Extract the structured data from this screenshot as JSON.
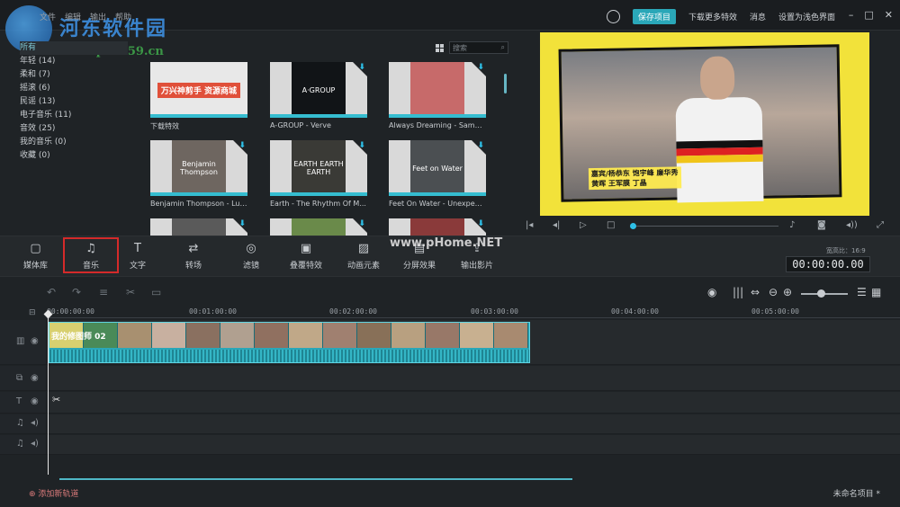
{
  "menu": [
    "文件",
    "编辑",
    "输出",
    "帮助"
  ],
  "watermark": {
    "site": "河东软件园",
    "url": "www.pc0359.cn",
    "overlay": "www.pHome.NET"
  },
  "titlebar": {
    "save": "保存项目",
    "download_effects": "下载更多特效",
    "messages": "消息",
    "light_theme": "设置为浅色界面"
  },
  "categories": [
    {
      "label": "所有",
      "active": true
    },
    {
      "label": "年轻 (14)"
    },
    {
      "label": "柔和 (7)"
    },
    {
      "label": "摇滚 (6)"
    },
    {
      "label": "民谣 (13)"
    },
    {
      "label": "电子音乐 (11)"
    },
    {
      "label": "音效 (25)"
    },
    {
      "label": "我的音乐 (0)"
    },
    {
      "label": "收藏 (0)"
    }
  ],
  "search": {
    "placeholder": "搜索"
  },
  "media": [
    {
      "caption": "下载特效",
      "thumb_text": "万兴神剪手 资源商城",
      "bg": "#e8e8e8"
    },
    {
      "caption": "A-GROUP - Verve",
      "thumb_text": "A·GROUP",
      "bg": "#111417"
    },
    {
      "caption": "Always Dreaming - Same ...",
      "thumb_text": "",
      "bg": "#c76a6a"
    },
    {
      "caption": "Benjamin Thompson - Lul...",
      "thumb_text": "Benjamin Thompson",
      "bg": "#6e6660"
    },
    {
      "caption": "Earth - The Rhythm Of M...",
      "thumb_text": "EARTH EARTH EARTH",
      "bg": "#3a3a36"
    },
    {
      "caption": "Feet On Water - Unexpect...",
      "thumb_text": "Feet on Water",
      "bg": "#4b4f52"
    },
    {
      "caption": "",
      "thumb_text": "",
      "bg": "#5a5a5a"
    },
    {
      "caption": "",
      "thumb_text": "",
      "bg": "#6a8a4a"
    },
    {
      "caption": "",
      "thumb_text": "",
      "bg": "#8a3a3a"
    }
  ],
  "preview": {
    "subtitle_line1": "嘉宾/杨恭东 饱宇峰 廉华秀",
    "subtitle_line2": "黄晖 王军膜 丁晶"
  },
  "toolbar": [
    {
      "label": "媒体库",
      "icon": "folder-icon"
    },
    {
      "label": "音乐",
      "icon": "music-note-icon",
      "active": true
    },
    {
      "label": "文字",
      "icon": "text-icon"
    },
    {
      "label": "转场",
      "icon": "transition-icon"
    },
    {
      "label": "滤镜",
      "icon": "filter-icon"
    },
    {
      "label": "叠覆特效",
      "icon": "overlay-icon"
    },
    {
      "label": "动画元素",
      "icon": "elements-icon"
    },
    {
      "label": "分屏效果",
      "icon": "split-screen-icon"
    },
    {
      "label": "输出影片",
      "icon": "export-icon"
    }
  ],
  "player": {
    "ratio": "宽高比：16:9",
    "timecode": "00:00:00.00"
  },
  "ruler": [
    "00:00:00:00",
    "00:01:00:00",
    "00:02:00:00",
    "00:03:00:00",
    "00:04:00:00",
    "00:05:00:00"
  ],
  "clip": {
    "title": "我的修图师 02"
  },
  "footer": {
    "add_track": "添加新轨道",
    "project_name": "未命名项目 *"
  }
}
